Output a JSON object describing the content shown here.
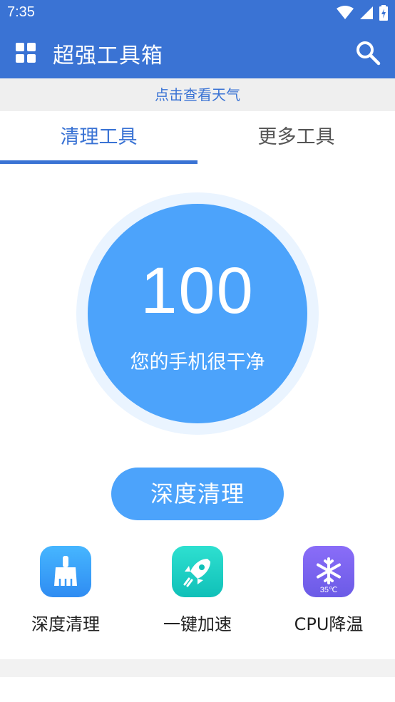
{
  "status": {
    "time": "7:35"
  },
  "appbar": {
    "title": "超强工具箱"
  },
  "weather": {
    "link_text": "点击查看天气"
  },
  "tabs": [
    {
      "label": "清理工具",
      "active": true
    },
    {
      "label": "更多工具",
      "active": false
    }
  ],
  "score": {
    "value": "100",
    "caption": "您的手机很干净"
  },
  "actions": {
    "deep_clean": "深度清理"
  },
  "tools": [
    {
      "label": "深度清理",
      "icon": "broom-icon",
      "color": "#3a9bf8"
    },
    {
      "label": "一键加速",
      "icon": "rocket-icon",
      "color": "#1ccfc2"
    },
    {
      "label": "CPU降温",
      "icon": "snowflake-icon",
      "color": "#7b63ef",
      "badge": "35℃"
    }
  ],
  "colors": {
    "primary": "#3a73d4",
    "accent": "#4ca3fb"
  }
}
